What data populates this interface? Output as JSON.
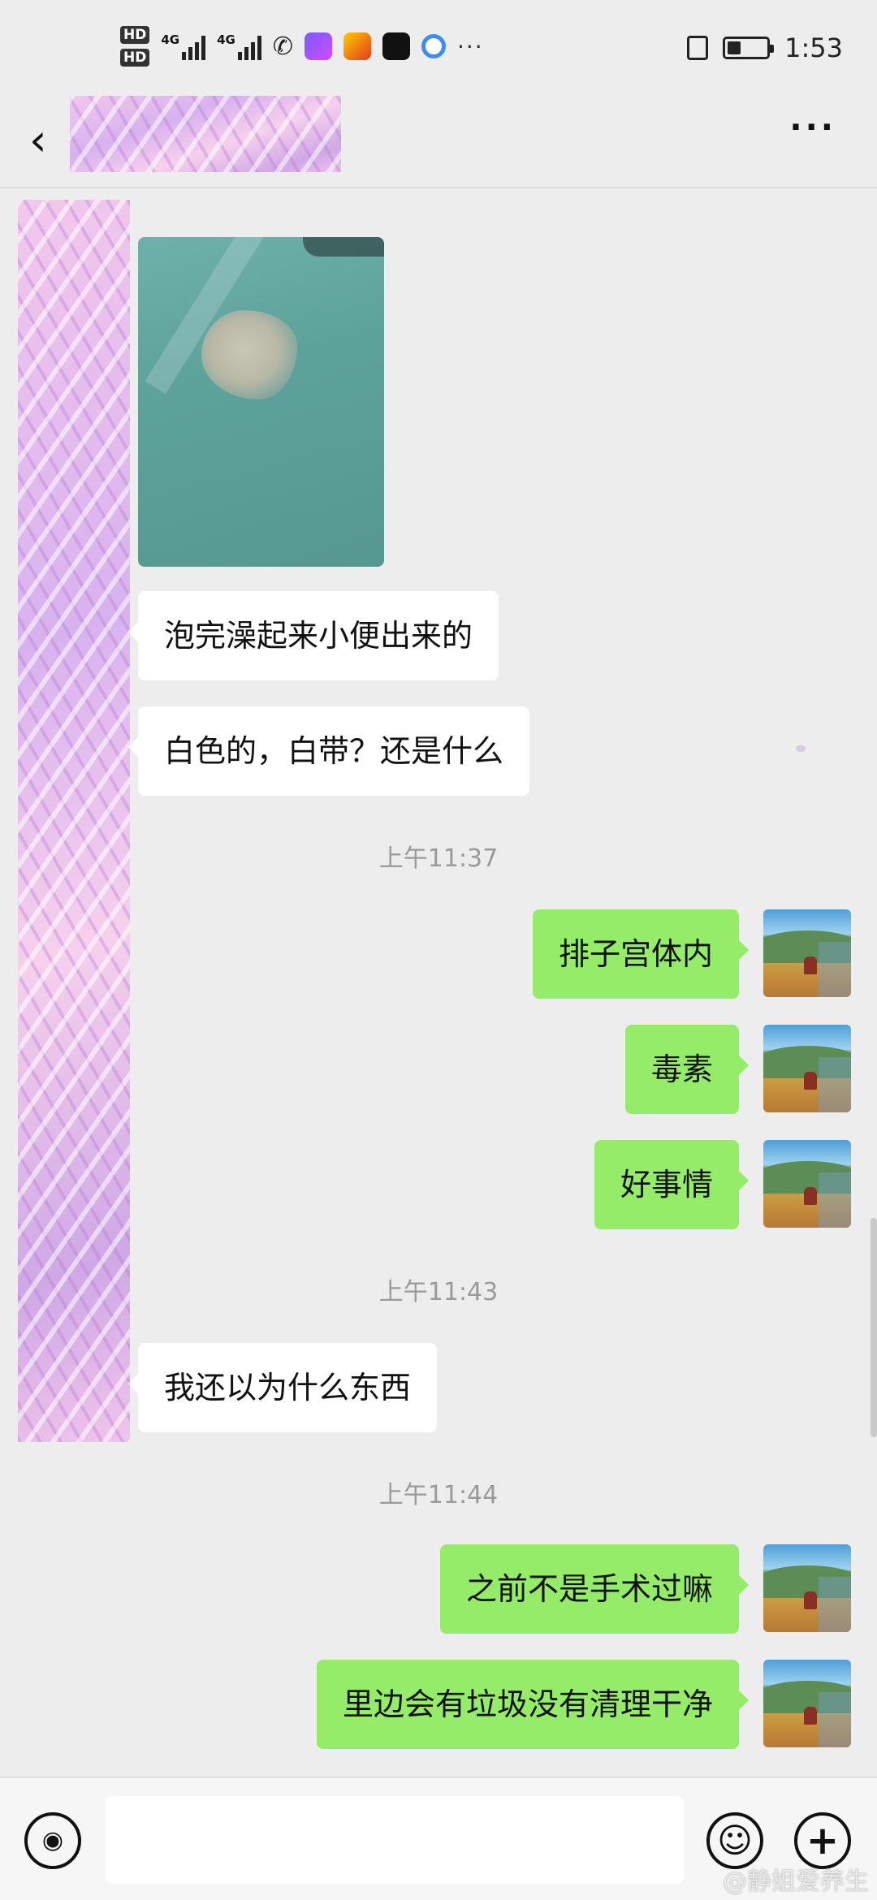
{
  "status_bar": {
    "hd1": "HD",
    "hd2": "HD",
    "net1": "4G",
    "net2": "4G",
    "more": "···",
    "time": "1:53",
    "battery_level": 0.35
  },
  "header": {
    "back_icon": "chevron-left-icon",
    "more_icon": "more-dots-icon",
    "more_label": "···"
  },
  "messages": [
    {
      "type": "image",
      "side": "in"
    },
    {
      "type": "text",
      "side": "in",
      "text": "泡完澡起来小便出来的"
    },
    {
      "type": "text",
      "side": "in",
      "text": "白色的，白带？还是什么"
    },
    {
      "type": "time",
      "text": "上午11:37"
    },
    {
      "type": "text",
      "side": "out",
      "text": "排子宫体内"
    },
    {
      "type": "text",
      "side": "out",
      "text": "毒素"
    },
    {
      "type": "text",
      "side": "out",
      "text": "好事情"
    },
    {
      "type": "time",
      "text": "上午11:43"
    },
    {
      "type": "text",
      "side": "in",
      "text": "我还以为什么东西"
    },
    {
      "type": "time",
      "text": "上午11:44"
    },
    {
      "type": "text",
      "side": "out",
      "text": "之前不是手术过嘛"
    },
    {
      "type": "text",
      "side": "out",
      "text": "里边会有垃圾没有清理干净"
    }
  ],
  "input_bar": {
    "voice_icon": "voice-icon",
    "emoji_icon": "emoji-icon",
    "plus_icon": "plus-icon",
    "voice_glyph": "◉",
    "emoji_glyph": "☺",
    "plus_glyph": "+"
  },
  "watermark": "@静姐爱养生",
  "colors": {
    "background": "#ededed",
    "outgoing_bubble": "#95ec69",
    "incoming_bubble": "#ffffff"
  }
}
